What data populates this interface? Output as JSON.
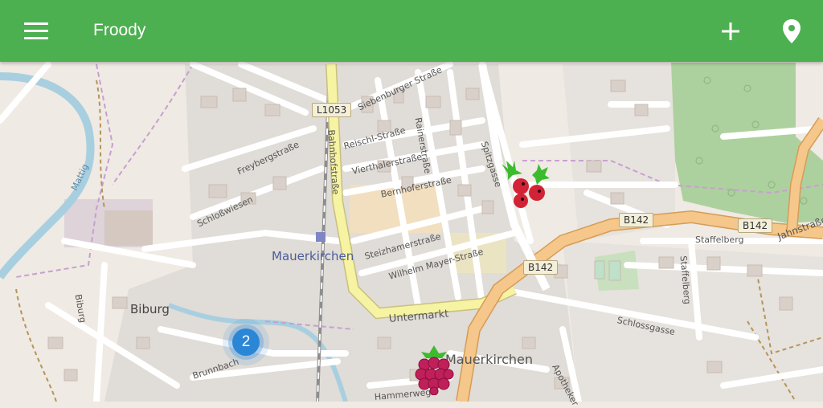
{
  "app": {
    "title": "Froody"
  },
  "toolbar": {
    "menu_icon": "hamburger-menu-icon",
    "add_icon": "plus-icon",
    "location_icon": "location-pin-icon"
  },
  "colors": {
    "appbar": "#4caf50",
    "cluster": "#2b86d6",
    "road_major": "#f5c78a",
    "road_yellow": "#f6f3a3"
  },
  "map": {
    "place_labels": {
      "town": "Mauerkirchen",
      "village": "Biburg",
      "district": "Mauerkirchen"
    },
    "road_shields": [
      "L1053",
      "B142",
      "B142",
      "B142"
    ],
    "street_labels": {
      "siebenburger": "Siebenburger Straße",
      "reischl": "Reischl-Straße",
      "vierthaler": "Vierthalerstraße",
      "bernhofer": "Bernhoferstraße",
      "rainer": "Rainerstraße",
      "bahnhof": "Bahnhofstraße",
      "freyberg": "Freybergstraße",
      "schlosswiesen": "Schloßwiesen",
      "steizhamer": "Steizhamerstraße",
      "wilhelm_mayer": "Wilhelm Mayer-Straße",
      "untermarkt": "Untermarkt",
      "spitzgasse": "Spitzgasse",
      "staffelberg_1": "Staffelberg",
      "staffelberg_2": "Staffelberg",
      "schlossgasse": "Schlossgasse",
      "jahnstrasse": "Jahnstraße",
      "biburg_road": "Biburg",
      "brunnbach": "Brunnbach",
      "hammerweg": "Hammerweg",
      "apotheker": "Apotheker",
      "mattig": "Mattig"
    },
    "cluster_count": "2",
    "markers": [
      {
        "type": "holly-berries",
        "icon": "holly-berry-icon"
      },
      {
        "type": "raspberry",
        "icon": "raspberry-icon"
      }
    ]
  }
}
